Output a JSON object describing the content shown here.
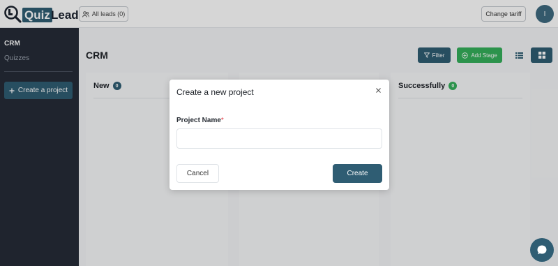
{
  "header": {
    "logo_quiz": "Quiz",
    "logo_lead": "Lead",
    "leads_label": "All leads (0)",
    "tariff_label": "Change tariff",
    "avatar_initial": "I"
  },
  "sidebar": {
    "items": [
      {
        "label": "CRM"
      },
      {
        "label": "Quizzes"
      }
    ],
    "create_label": "Create a project"
  },
  "main": {
    "title": "CRM",
    "filter_label": "Filter",
    "add_stage_label": "Add Stage",
    "columns": [
      {
        "name": "New",
        "count": "0",
        "badge_color": "#2f5d73"
      },
      {
        "name": "",
        "count": ""
      },
      {
        "name": "Successfully",
        "count": "0",
        "badge_color": "#35b05b"
      }
    ]
  },
  "modal": {
    "title": "Create a new project",
    "field_label": "Project Name",
    "required_mark": "*",
    "input_value": "",
    "input_placeholder": "",
    "cancel_label": "Cancel",
    "create_label": "Create"
  },
  "colors": {
    "primary": "#2f5d73",
    "success": "#35b05b",
    "sidebar_bg": "#252b37",
    "required": "#e0404a"
  },
  "icons": [
    "magnifier-logo-icon",
    "users-icon",
    "plus-icon",
    "filter-icon",
    "plus-circle-icon",
    "list-view-icon",
    "grid-view-icon",
    "close-icon",
    "chat-icon"
  ]
}
